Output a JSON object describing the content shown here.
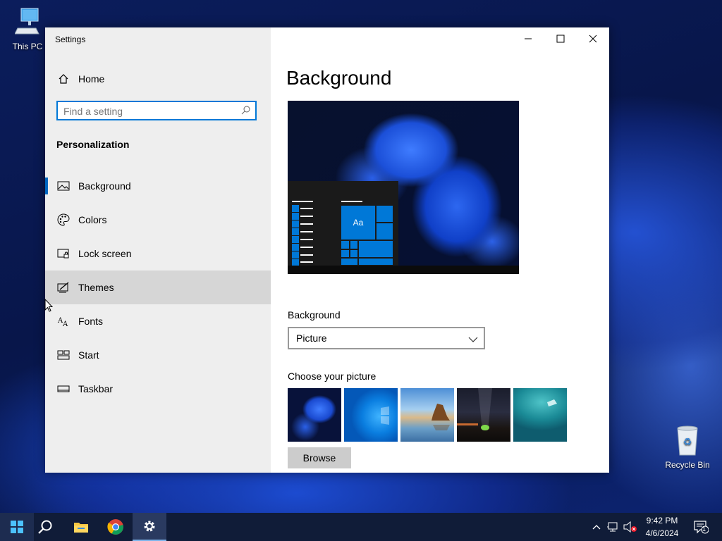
{
  "desktop": {
    "icons": [
      {
        "label": "This PC"
      },
      {
        "label": "Recycle Bin"
      }
    ]
  },
  "window": {
    "title": "Settings",
    "controls": {
      "minimize": "minimize-icon",
      "maximize": "maximize-icon",
      "close": "close-icon"
    }
  },
  "sidebar": {
    "home_label": "Home",
    "search_placeholder": "Find a setting",
    "section_title": "Personalization",
    "items": [
      {
        "label": "Background",
        "icon": "picture-icon",
        "selected": true
      },
      {
        "label": "Colors",
        "icon": "palette-icon"
      },
      {
        "label": "Lock screen",
        "icon": "lock-screen-icon"
      },
      {
        "label": "Themes",
        "icon": "themes-icon",
        "hovered": true
      },
      {
        "label": "Fonts",
        "icon": "fonts-icon"
      },
      {
        "label": "Start",
        "icon": "start-icon"
      },
      {
        "label": "Taskbar",
        "icon": "taskbar-icon"
      }
    ]
  },
  "main": {
    "title": "Background",
    "preview_tile_text": "Aa",
    "background_label": "Background",
    "background_value": "Picture",
    "choose_label": "Choose your picture",
    "browse_label": "Browse"
  },
  "taskbar": {
    "time": "9:42 PM",
    "date": "4/6/2024",
    "notification_count": "1",
    "apps": [
      "start-icon",
      "search-icon",
      "file-explorer-icon",
      "chrome-icon",
      "settings-icon"
    ]
  },
  "colors": {
    "accent": "#0078d7",
    "sidebar_bg": "#eeeeee",
    "taskbar_bg": "#101c38"
  }
}
